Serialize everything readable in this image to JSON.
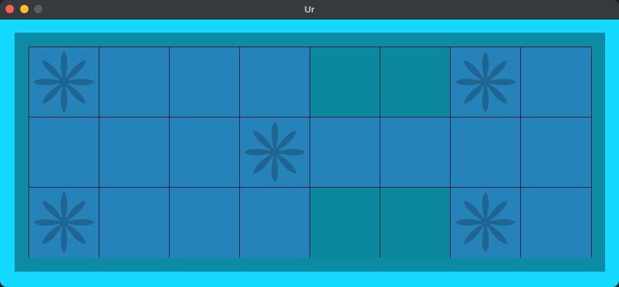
{
  "window": {
    "title": "Ur"
  },
  "colors": {
    "content_background": "#14d9ff",
    "board_frame": "#0d8ba4",
    "square": "#2683ba",
    "gap_square": "#0c889e",
    "rosette": "#1e6591",
    "grid_line": "#0b1c3a"
  },
  "board": {
    "rows": 3,
    "columns": 8,
    "cells": [
      [
        "rosette",
        "square",
        "square",
        "square",
        "empty",
        "empty",
        "rosette",
        "square"
      ],
      [
        "square",
        "square",
        "square",
        "rosette",
        "square",
        "square",
        "square",
        "square"
      ],
      [
        "rosette",
        "square",
        "square",
        "square",
        "empty",
        "empty",
        "rosette",
        "square"
      ]
    ]
  }
}
